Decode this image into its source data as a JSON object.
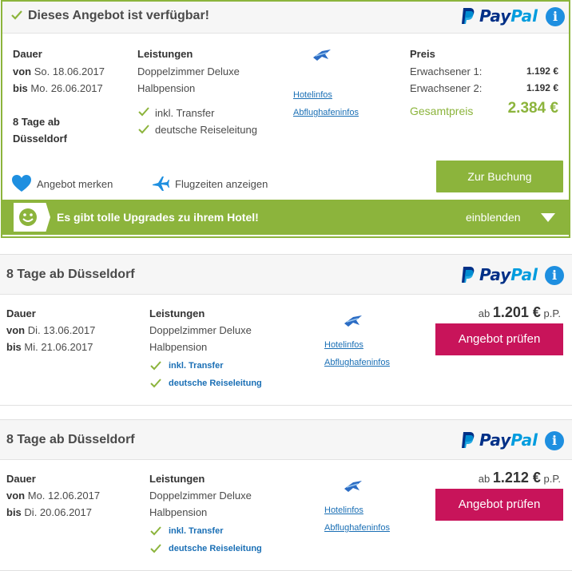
{
  "offers": [
    {
      "status_title": "Dieses Angebot ist verfügbar!",
      "payment_logo": "PayPal",
      "duration_label": "Dauer",
      "from_word": "von",
      "from_date": "So. 18.06.2017",
      "to_word": "bis",
      "to_date": "Mo. 26.06.2017",
      "trip_line1": "8 Tage ab",
      "trip_line2": "Düsseldorf",
      "services_label": "Leistungen",
      "room": "Doppelzimmer Deluxe",
      "board": "Halbpension",
      "features": [
        "inkl. Transfer",
        "deutsche Reiseleitung"
      ],
      "hotel_link": "Hotelinfos",
      "airport_link": "Abflughafeninfos",
      "price_label": "Preis",
      "price_rows": [
        {
          "label": "Erwachsener 1:",
          "value": "1.192 €"
        },
        {
          "label": "Erwachsener 2:",
          "value": "1.192 €"
        }
      ],
      "total_label": "Gesamtpreis",
      "total_value": "2.384 €",
      "save_label": "Angebot merken",
      "flight_times_label": "Flugzeiten anzeigen",
      "booking_button": "Zur Buchung",
      "upgrade_text": "Es gibt tolle Upgrades zu ihrem Hotel!",
      "upgrade_toggle": "einblenden"
    },
    {
      "title": "8 Tage ab Düsseldorf",
      "payment_logo": "PayPal",
      "duration_label": "Dauer",
      "from_word": "von",
      "from_date": "Di. 13.06.2017",
      "to_word": "bis",
      "to_date": "Mi. 21.06.2017",
      "services_label": "Leistungen",
      "room": "Doppelzimmer Deluxe",
      "board": "Halbpension",
      "features": [
        "inkl. Transfer",
        "deutsche Reiseleitung"
      ],
      "hotel_link": "Hotelinfos",
      "airport_link": "Abflughafeninfos",
      "price_prefix": "ab",
      "price": "1.201 €",
      "price_suffix": "p.P.",
      "check_button": "Angebot prüfen"
    },
    {
      "title": "8 Tage ab Düsseldorf",
      "payment_logo": "PayPal",
      "duration_label": "Dauer",
      "from_word": "von",
      "from_date": "Mo. 12.06.2017",
      "to_word": "bis",
      "to_date": "Di. 20.06.2017",
      "services_label": "Leistungen",
      "room": "Doppelzimmer Deluxe",
      "board": "Halbpension",
      "features": [
        "inkl. Transfer",
        "deutsche Reiseleitung"
      ],
      "hotel_link": "Hotelinfos",
      "airport_link": "Abflughafeninfos",
      "price_prefix": "ab",
      "price": "1.212 €",
      "price_suffix": "p.P.",
      "check_button": "Angebot prüfen"
    }
  ],
  "icons": {
    "status": "check-icon",
    "info": "info-icon",
    "airline": "airline-logo-icon",
    "heart": "heart-icon",
    "plane": "plane-icon",
    "smiley": "smiley-icon",
    "toggle": "triangle-down-icon"
  },
  "colors": {
    "accent_green": "#8cb43c",
    "cta_pink": "#c8145a",
    "link_blue": "#1a6fb5",
    "paypal_dark": "#003087",
    "paypal_light": "#009cde",
    "info_blue": "#1e8fe0"
  }
}
